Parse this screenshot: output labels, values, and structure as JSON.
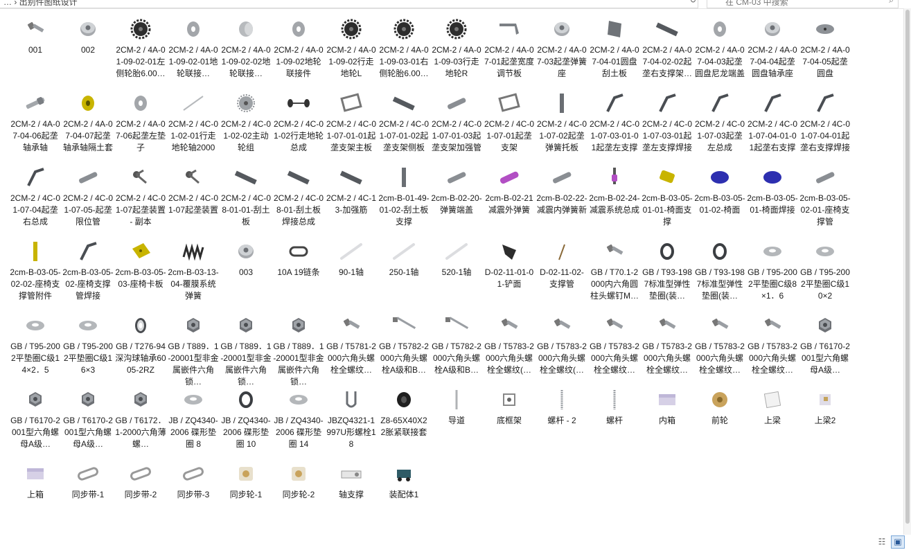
{
  "colors": {
    "accent": "#3c78c8",
    "metal": "#8a8e93",
    "dark": "#2d2d2d",
    "yellow": "#c8b400",
    "purple": "#b24fc4",
    "blue": "#2d2fb0"
  },
  "addressbar": {
    "text": "… › 出别件图纸设计",
    "refresh": "↻"
  },
  "search": {
    "placeholder": "在 CM-03 中搜索"
  },
  "files": [
    {
      "label": "001",
      "icon": "bolt"
    },
    {
      "label": "002",
      "icon": "nut"
    },
    {
      "label": "2CM-2 / 4A-01-09-02-01左侧轮胎6.00…",
      "icon": "gear-dark"
    },
    {
      "label": "2CM-2 / 4A-01-09-02-01地轮联接…",
      "icon": "washer"
    },
    {
      "label": "2CM-2 / 4A-01-09-02-02地轮联接…",
      "icon": "cylinder"
    },
    {
      "label": "2CM-2 / 4A-01-09-02地轮联接件",
      "icon": "washer"
    },
    {
      "label": "2CM-2 / 4A-01-09-02行走地轮L",
      "icon": "gear-dark"
    },
    {
      "label": "2CM-2 / 4A-01-09-03-01右侧轮胎6.00…",
      "icon": "gear-dark"
    },
    {
      "label": "2CM-2 / 4A-01-09-03行走地轮R",
      "icon": "gear-dark"
    },
    {
      "label": "2CM-2 / 4A-07-01起垄宽度调节板",
      "icon": "bracket"
    },
    {
      "label": "2CM-2 / 4A-07-03起垄弹簧座",
      "icon": "nut"
    },
    {
      "label": "2CM-2 / 4A-07-04-01圆盘刮土板",
      "icon": "plate"
    },
    {
      "label": "2CM-2 / 4A-07-04-02-02起垄右支撑架…",
      "icon": "bar"
    },
    {
      "label": "2CM-2 / 4A-07-04-03起垄圆盘尼龙端盖",
      "icon": "washer"
    },
    {
      "label": "2CM-2 / 4A-07-04-04起垄圆盘轴承座",
      "icon": "nut"
    },
    {
      "label": "2CM-2 / 4A-07-04-05起垄圆盘",
      "icon": "disc"
    },
    {
      "label": "2CM-2 / 4A-07-04-06起垄轴承轴",
      "icon": "shaft"
    },
    {
      "label": "2CM-2 / 4A-07-04-07起垄轴承轴隔土套",
      "icon": "ring-yellow"
    },
    {
      "label": "2CM-2 / 4A-07-06起垄左垫子",
      "icon": "washer"
    },
    {
      "label": "2CM-2 / 4C-01-02-01行走地轮轴2000",
      "icon": "rod"
    },
    {
      "label": "2CM-2 / 4C-01-02-02主动轮组",
      "icon": "gear"
    },
    {
      "label": "2CM-2 / 4C-01-02行走地轮总成",
      "icon": "axle"
    },
    {
      "label": "2CM-2 / 4C-01-07-01-01起垄支架主板",
      "icon": "frame"
    },
    {
      "label": "2CM-2 / 4C-01-07-01-02起垄支架侧板",
      "icon": "bar"
    },
    {
      "label": "2CM-2 / 4C-01-07-01-03起垄支架加强管",
      "icon": "tube"
    },
    {
      "label": "2CM-2 / 4C-01-07-01起垄支架",
      "icon": "frame"
    },
    {
      "label": "2CM-2 / 4C-01-07-02起垄弹簧托板",
      "icon": "post"
    },
    {
      "label": "2CM-2 / 4C-01-07-03-01-01起垄左支撑",
      "icon": "arm"
    },
    {
      "label": "2CM-2 / 4C-01-07-03-01起垄左支撑焊接",
      "icon": "arm"
    },
    {
      "label": "2CM-2 / 4C-01-07-03起垄左总成",
      "icon": "arm"
    },
    {
      "label": "2CM-2 / 4C-01-07-04-01-01起垄右支撑",
      "icon": "arm"
    },
    {
      "label": "2CM-2 / 4C-01-07-04-01起垄右支撑焊接",
      "icon": "arm"
    },
    {
      "label": "2CM-2 / 4C-01-07-04起垄右总成",
      "icon": "arm"
    },
    {
      "label": "2CM-2 / 4C-01-07-05-起垄限位管",
      "icon": "tube"
    },
    {
      "label": "2CM-2 / 4C-01-07起垄装置 - 副本",
      "icon": "assembly"
    },
    {
      "label": "2CM-2 / 4C-01-07起垄装置",
      "icon": "assembly"
    },
    {
      "label": "2CM-2 / 4C-08-01-01-刮土板",
      "icon": "bar"
    },
    {
      "label": "2CM-2 / 4C-08-01-刮土板焊接总成",
      "icon": "bar"
    },
    {
      "label": "2CM-2 / 4C-13-加强筋",
      "icon": "bar"
    },
    {
      "label": "2cm-B-01-49-01-02-刮土板支撑",
      "icon": "post"
    },
    {
      "label": "2cm-B-02-20-弹簧端盖",
      "icon": "tube"
    },
    {
      "label": "2cm-B-02-21减震外弹簧",
      "icon": "spring-purple"
    },
    {
      "label": "2cm-B-02-22-减震内弹簧新",
      "icon": "tube"
    },
    {
      "label": "2cm-B-02-24-减震系统总成",
      "icon": "pin-purple"
    },
    {
      "label": "2cm-B-03-05-01-01-椅面支撑",
      "icon": "block-yellow"
    },
    {
      "label": "2cm-B-03-05-01-02-椅面",
      "icon": "seat-blue"
    },
    {
      "label": "2cm-B-03-05-01-椅面焊接",
      "icon": "seat-blue"
    },
    {
      "label": "2cm-B-03-05-02-01-座椅支撑管",
      "icon": "tube"
    },
    {
      "label": "2cm-B-03-05-02-02-座椅支撑管附件",
      "icon": "post-yellow"
    },
    {
      "label": "2cm-B-03-05-02-座椅支撑管焊接",
      "icon": "arm"
    },
    {
      "label": "2cm-B-03-05-03-座椅卡板",
      "icon": "plate-yellow"
    },
    {
      "label": "2cm-B-03-13-04-覆膜系统弹簧",
      "icon": "spring"
    },
    {
      "label": "003",
      "icon": "nut"
    },
    {
      "label": "10A 19链条",
      "icon": "link"
    },
    {
      "label": "90-1轴",
      "icon": "rod-light"
    },
    {
      "label": "250-1轴",
      "icon": "rod-light"
    },
    {
      "label": "520-1轴",
      "icon": "rod-light"
    },
    {
      "label": "D-02-11-01-01-铲面",
      "icon": "blade"
    },
    {
      "label": "D-02-11-02-支撑管",
      "icon": "stick"
    },
    {
      "label": "GB / T70.1-2000内六角圆柱头螺钉M…",
      "icon": "bolt"
    },
    {
      "label": "GB / T93-1987标准型弹性垫圈(装…",
      "icon": "ring-dark"
    },
    {
      "label": "GB / T93-1987标准型弹性垫圈(装…",
      "icon": "ring-dark"
    },
    {
      "label": "GB / T95-2002平垫圈C级8×1．6",
      "icon": "washer-flat"
    },
    {
      "label": "GB / T95-2002平垫圈C级10×2",
      "icon": "washer-flat"
    },
    {
      "label": "GB / T95-2002平垫圈C级14×2．5",
      "icon": "washer-flat"
    },
    {
      "label": "GB / T95-2002平垫圈C级16×3",
      "icon": "washer-flat"
    },
    {
      "label": "GB / T276-94深沟球轴承6005-2RZ",
      "icon": "bearing"
    },
    {
      "label": "GB / T889．1-20001型非金属嵌件六角锁…",
      "icon": "hexnut"
    },
    {
      "label": "GB / T889．1-20001型非金属嵌件六角锁…",
      "icon": "hexnut"
    },
    {
      "label": "GB / T889．1-20001型非金属嵌件六角锁…",
      "icon": "hexnut"
    },
    {
      "label": "GB / T5781-2000六角头螺栓全螺纹…",
      "icon": "bolt"
    },
    {
      "label": "GB / T5782-2000六角头螺栓A级和B…",
      "icon": "bolt-long"
    },
    {
      "label": "GB / T5782-2000六角头螺栓A级和B…",
      "icon": "bolt-long"
    },
    {
      "label": "GB / T5783-2000六角头螺栓全螺纹(…",
      "icon": "bolt"
    },
    {
      "label": "GB / T5783-2000六角头螺栓全螺纹(…",
      "icon": "bolt"
    },
    {
      "label": "GB / T5783-2000六角头螺栓全螺纹…",
      "icon": "bolt"
    },
    {
      "label": "GB / T5783-2000六角头螺栓全螺纹…",
      "icon": "bolt"
    },
    {
      "label": "GB / T5783-2000六角头螺栓全螺纹…",
      "icon": "bolt"
    },
    {
      "label": "GB / T5783-2000六角头螺栓全螺纹…",
      "icon": "bolt"
    },
    {
      "label": "GB / T6170-2001型六角螺母A级…",
      "icon": "hexnut"
    },
    {
      "label": "GB / T6170-2001型六角螺母A级…",
      "icon": "hexnut"
    },
    {
      "label": "GB / T6170-2001型六角螺母A级…",
      "icon": "hexnut"
    },
    {
      "label": "GB / T6172．1-2000六角薄螺…",
      "icon": "hexnut"
    },
    {
      "label": "JB / ZQ4340-2006 碟形垫圈 8",
      "icon": "washer-flat"
    },
    {
      "label": "JB / ZQ4340-2006 碟形垫圈 10",
      "icon": "ring-dark"
    },
    {
      "label": "JB / ZQ4340-2006 碟形垫圈 14",
      "icon": "washer-flat"
    },
    {
      "label": "JBZQ4321-1997U形螺栓18",
      "icon": "ubolt"
    },
    {
      "label": "Z8-65X40X22胀紧联接套",
      "icon": "sleeve"
    },
    {
      "label": "导道",
      "icon": "rod-vertical"
    },
    {
      "label": "底框架",
      "icon": "assembly-small"
    },
    {
      "label": "螺杆 - 2",
      "icon": "screw"
    },
    {
      "label": "螺杆",
      "icon": "screw"
    },
    {
      "label": "内箱",
      "icon": "box"
    },
    {
      "label": "前轮",
      "icon": "wheel-gold"
    },
    {
      "label": "上梁",
      "icon": "block-white"
    },
    {
      "label": "上梁2",
      "icon": "box-small"
    },
    {
      "label": "上箱",
      "icon": "box"
    },
    {
      "label": "同步带-1",
      "icon": "belt"
    },
    {
      "label": "同步带-2",
      "icon": "belt"
    },
    {
      "label": "同步带-3",
      "icon": "belt"
    },
    {
      "label": "同步轮-1",
      "icon": "pulley"
    },
    {
      "label": "同步轮-2",
      "icon": "pulley"
    },
    {
      "label": "轴支撑",
      "icon": "support"
    },
    {
      "label": "装配体1",
      "icon": "assembly-teal"
    }
  ],
  "statusbar": {
    "details_view": "☷",
    "icons_view": "▣"
  }
}
